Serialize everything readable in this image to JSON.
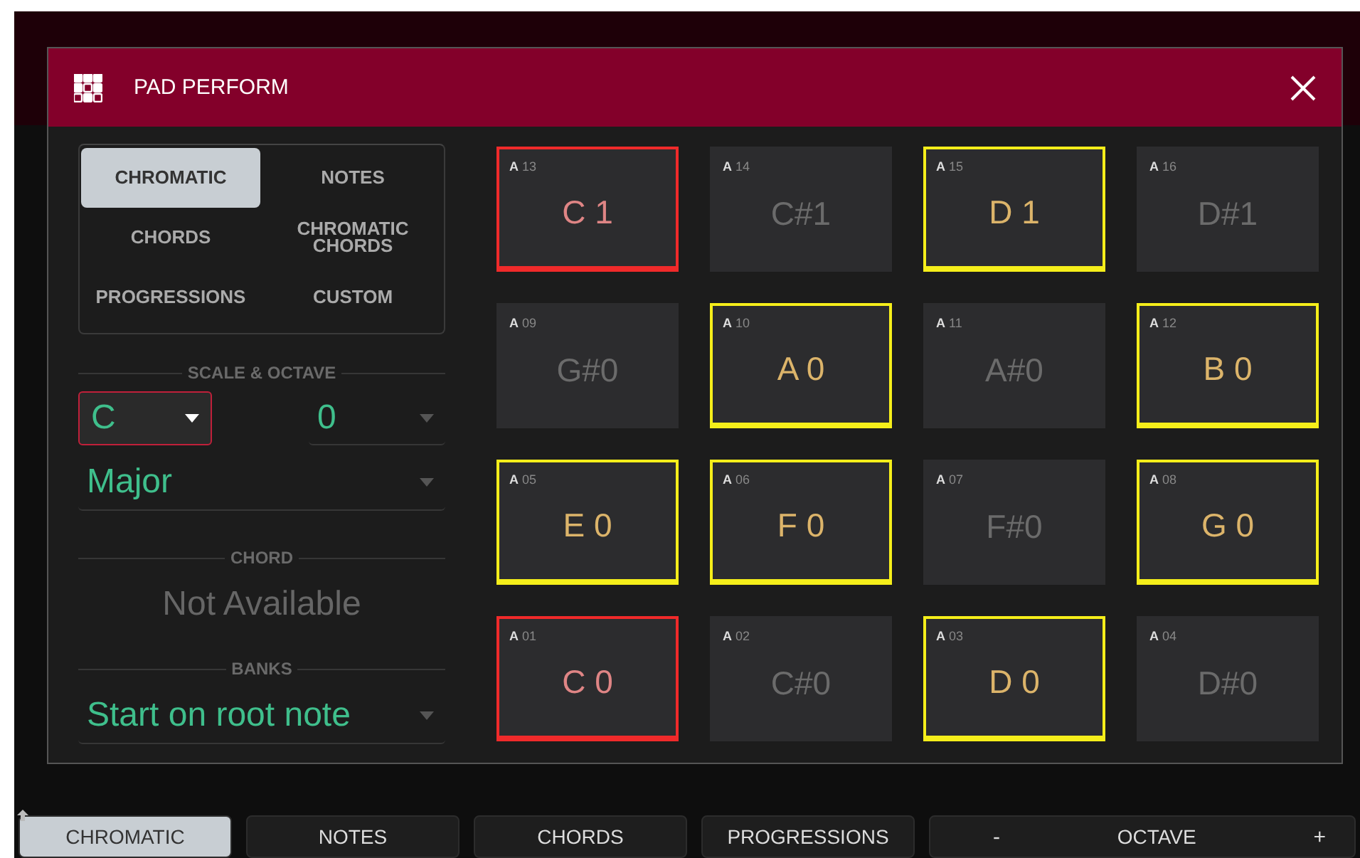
{
  "dialog": {
    "title": "PAD PERFORM"
  },
  "modes": [
    {
      "label": "CHROMATIC",
      "selected": true
    },
    {
      "label": "NOTES",
      "selected": false
    },
    {
      "label": "CHORDS",
      "selected": false
    },
    {
      "label": "CHROMATIC CHORDS",
      "selected": false
    },
    {
      "label": "PROGRESSIONS",
      "selected": false
    },
    {
      "label": "CUSTOM",
      "selected": false
    }
  ],
  "scale_section": {
    "heading": "SCALE & OCTAVE",
    "root": {
      "value": "C",
      "focused": true
    },
    "octave": {
      "value": "0",
      "focused": false
    },
    "scale": {
      "value": "Major",
      "focused": false
    }
  },
  "chord_section": {
    "heading": "CHORD",
    "value": "Not Available"
  },
  "banks_section": {
    "heading": "BANKS",
    "value": "Start on root note",
    "focused": false
  },
  "pads": [
    {
      "bank": "A",
      "number": "13",
      "note": "C 1",
      "kind": "root"
    },
    {
      "bank": "A",
      "number": "14",
      "note": "C#1",
      "kind": "off"
    },
    {
      "bank": "A",
      "number": "15",
      "note": "D 1",
      "kind": "scale"
    },
    {
      "bank": "A",
      "number": "16",
      "note": "D#1",
      "kind": "off"
    },
    {
      "bank": "A",
      "number": "09",
      "note": "G#0",
      "kind": "off"
    },
    {
      "bank": "A",
      "number": "10",
      "note": "A 0",
      "kind": "scale"
    },
    {
      "bank": "A",
      "number": "11",
      "note": "A#0",
      "kind": "off"
    },
    {
      "bank": "A",
      "number": "12",
      "note": "B 0",
      "kind": "scale"
    },
    {
      "bank": "A",
      "number": "05",
      "note": "E 0",
      "kind": "scale"
    },
    {
      "bank": "A",
      "number": "06",
      "note": "F 0",
      "kind": "scale"
    },
    {
      "bank": "A",
      "number": "07",
      "note": "F#0",
      "kind": "off"
    },
    {
      "bank": "A",
      "number": "08",
      "note": "G 0",
      "kind": "scale"
    },
    {
      "bank": "A",
      "number": "01",
      "note": "C 0",
      "kind": "root"
    },
    {
      "bank": "A",
      "number": "02",
      "note": "C#0",
      "kind": "off"
    },
    {
      "bank": "A",
      "number": "03",
      "note": "D 0",
      "kind": "scale"
    },
    {
      "bank": "A",
      "number": "04",
      "note": "D#0",
      "kind": "off"
    }
  ],
  "bottom_tabs": [
    {
      "label": "CHROMATIC",
      "selected": true
    },
    {
      "label": "NOTES",
      "selected": false
    },
    {
      "label": "CHORDS",
      "selected": false
    },
    {
      "label": "PROGRESSIONS",
      "selected": false
    }
  ],
  "octave_control": {
    "minus": "-",
    "label": "OCTAVE",
    "plus": "+"
  }
}
